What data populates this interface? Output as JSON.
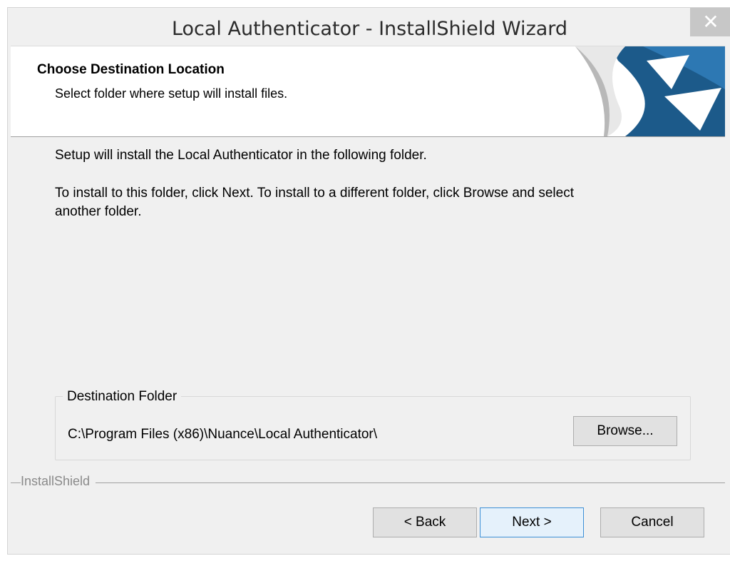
{
  "window": {
    "title": "Local Authenticator - InstallShield Wizard",
    "close_symbol": "✕"
  },
  "header": {
    "title": "Choose Destination Location",
    "subtitle": "Select folder where setup will install files."
  },
  "body": {
    "line1": "Setup will install the Local Authenticator in the following folder.",
    "line2a": "To install to this folder, click Next. To install to a different folder, click Browse and select",
    "line2b": "another folder."
  },
  "destination": {
    "legend": "Destination Folder",
    "path": "C:\\Program Files (x86)\\Nuance\\Local Authenticator\\",
    "browse_label": "Browse..."
  },
  "footer": {
    "brand": "InstallShield",
    "back_label": "< Back",
    "next_label": "Next >",
    "cancel_label": "Cancel"
  },
  "colors": {
    "brand_blue": "#1c5a8a",
    "default_button_border": "#3c8fd6",
    "close_button": "#c7c7c7"
  }
}
